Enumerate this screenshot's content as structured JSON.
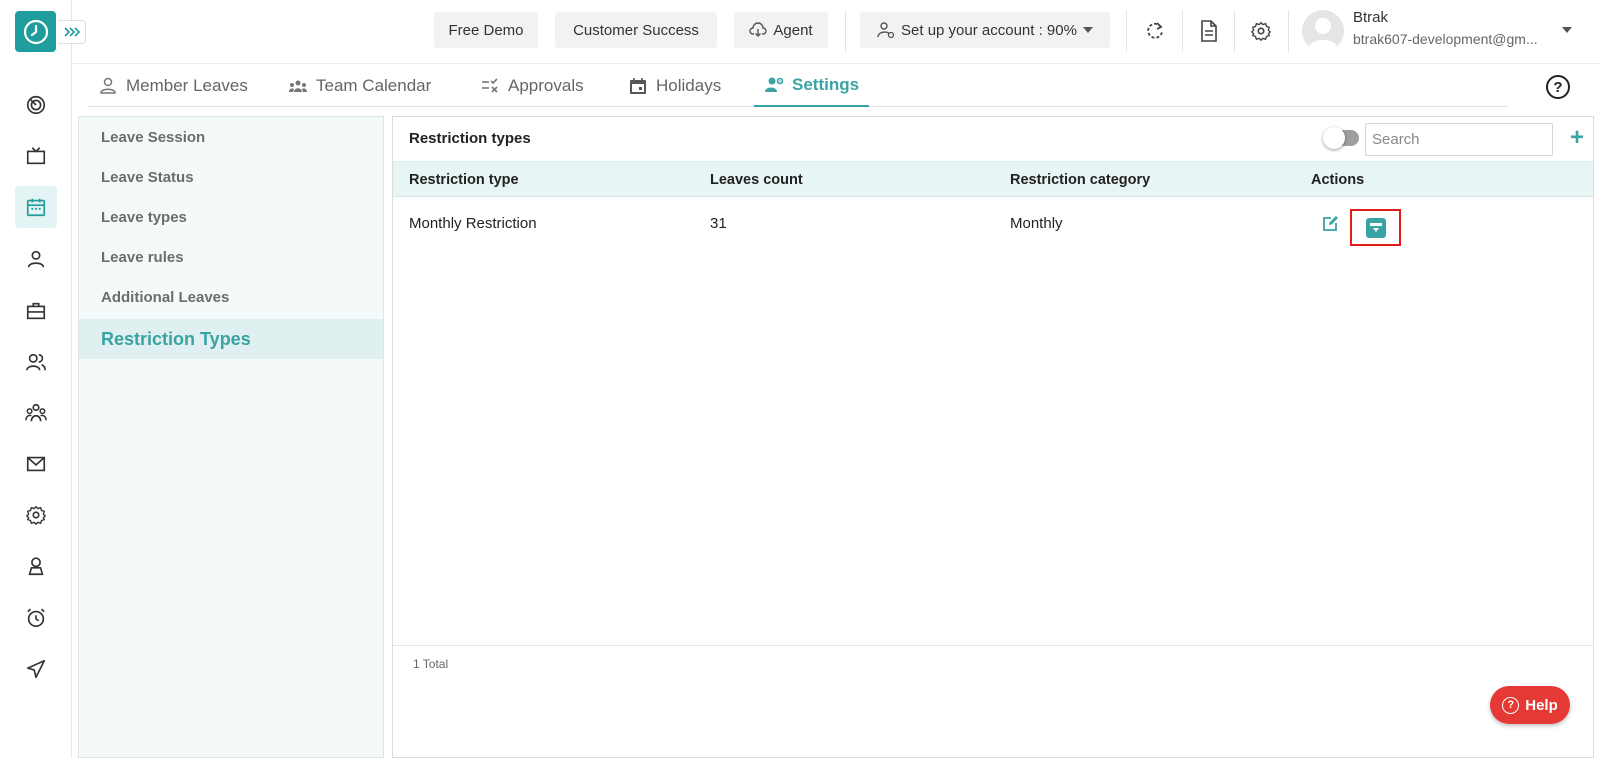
{
  "header": {
    "free_demo": "Free Demo",
    "customer_success": "Customer Success",
    "agent": "Agent",
    "setup_account": "Set up your account : 90%",
    "user_name": "Btrak",
    "user_email": "btrak607-development@gm..."
  },
  "tabs": [
    {
      "label": "Member Leaves",
      "icon": "person-icon"
    },
    {
      "label": "Team Calendar",
      "icon": "team-icon"
    },
    {
      "label": "Approvals",
      "icon": "approvals-icon"
    },
    {
      "label": "Holidays",
      "icon": "calendar-icon"
    },
    {
      "label": "Settings",
      "icon": "user-settings-icon"
    }
  ],
  "sidemenu": {
    "items": [
      {
        "label": "Leave Session"
      },
      {
        "label": "Leave Status"
      },
      {
        "label": "Leave types"
      },
      {
        "label": "Leave rules"
      },
      {
        "label": "Additional Leaves"
      },
      {
        "label": "Restriction Types"
      }
    ]
  },
  "card": {
    "title": "Restriction types",
    "search_placeholder": "Search",
    "add_label": "+",
    "columns": [
      "Restriction type",
      "Leaves count",
      "Restriction category",
      "Actions"
    ],
    "rows": [
      {
        "type": "Monthly Restriction",
        "count": "31",
        "category": "Monthly"
      }
    ],
    "total": "1 Total"
  },
  "help": {
    "label": "Help",
    "icon_glyph": "?"
  },
  "help_glyph": "?",
  "colors": {
    "accent": "#3aa3a3",
    "logo": "#1f9c9c",
    "danger": "#e53935"
  }
}
